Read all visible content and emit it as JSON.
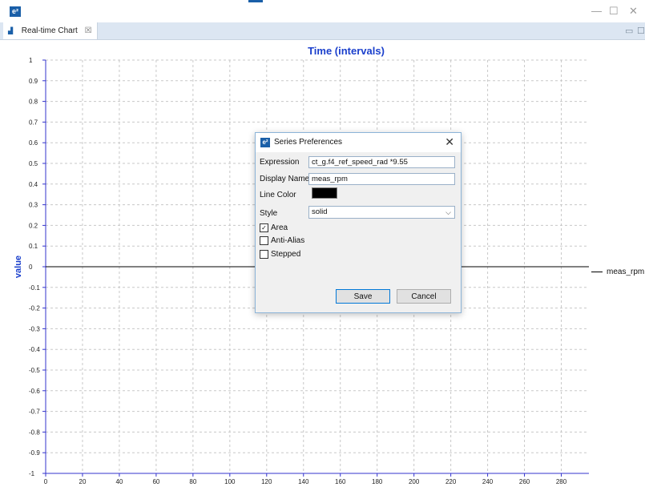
{
  "window": {
    "logo": "e²",
    "minimize": "—",
    "maximize": "☐",
    "close": "✕"
  },
  "tab": {
    "icon": "real-time-chart-icon",
    "label": "Real-time Chart",
    "close": "☒"
  },
  "view_controls": {
    "minimize": "▭",
    "maximize": "☐"
  },
  "chart_data": {
    "type": "line",
    "title": "Time (intervals)",
    "xlabel": "",
    "ylabel": "value",
    "xlim": [
      0,
      295
    ],
    "ylim": [
      -1,
      1
    ],
    "x_ticks": [
      0,
      20,
      40,
      60,
      80,
      100,
      120,
      140,
      160,
      180,
      200,
      220,
      240,
      260,
      280
    ],
    "y_ticks": [
      1,
      0.9,
      0.8,
      0.7,
      0.6,
      0.5,
      0.4,
      0.3,
      0.2,
      0.1,
      0,
      -0.1,
      -0.2,
      -0.3,
      -0.4,
      -0.5,
      -0.6,
      -0.7,
      -0.8,
      -0.9,
      -1
    ],
    "grid": true,
    "legend_position": "right",
    "series": [
      {
        "name": "meas_rpm",
        "color": "#000000",
        "x": [
          0,
          295
        ],
        "y": [
          0,
          0
        ]
      }
    ],
    "colors": {
      "title": "#1a3fcc",
      "axis": "#3333cc",
      "grid": "#c8c8c8"
    }
  },
  "dialog": {
    "title": "Series Preferences",
    "close": "✕",
    "expression_label": "Expression",
    "expression_value": "ct_g.f4_ref_speed_rad *9.55",
    "display_name_label": "Display Name",
    "display_name_value": "meas_rpm",
    "line_color_label": "Line Color",
    "line_color_value": "#000000",
    "style_label": "Style",
    "style_value": "solid",
    "checkboxes": [
      {
        "label": "Area",
        "checked": true
      },
      {
        "label": "Anti-Alias",
        "checked": false
      },
      {
        "label": "Stepped",
        "checked": false
      }
    ],
    "save_label": "Save",
    "cancel_label": "Cancel"
  }
}
